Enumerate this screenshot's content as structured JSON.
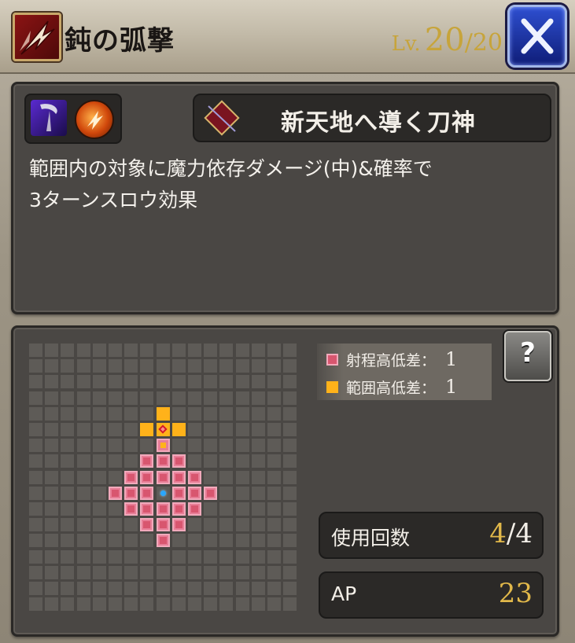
{
  "header": {
    "skill_name": "鈍の弧撃",
    "level_prefix": "Lv.",
    "level_current": "20",
    "level_separator": "/",
    "level_max": "20",
    "skill_type_icon": "slash-icon",
    "close_icon": "close-icon"
  },
  "info": {
    "element_icons": [
      "weapon-scythe-icon",
      "fire-element-icon"
    ],
    "source_icon": "book-icon",
    "source_name": "新天地へ導く刀神",
    "description": "範囲内の対象に魔力依存ダメージ(中)&確率で\n3ターンスロウ効果"
  },
  "range_map": {
    "grid_size": 17,
    "colors": {
      "range": "#d8566f",
      "area": "#ffb21a",
      "origin": "#2aa7ff"
    },
    "range_cells": [
      [
        8,
        6
      ],
      [
        8,
        7
      ],
      [
        7,
        7
      ],
      [
        9,
        7
      ],
      [
        6,
        8
      ],
      [
        7,
        8
      ],
      [
        8,
        8
      ],
      [
        9,
        8
      ],
      [
        10,
        8
      ],
      [
        5,
        9
      ],
      [
        6,
        9
      ],
      [
        7,
        9
      ],
      [
        9,
        9
      ],
      [
        10,
        9
      ],
      [
        11,
        9
      ],
      [
        6,
        10
      ],
      [
        7,
        10
      ],
      [
        8,
        10
      ],
      [
        9,
        10
      ],
      [
        10,
        10
      ],
      [
        7,
        11
      ],
      [
        8,
        11
      ],
      [
        9,
        11
      ],
      [
        8,
        12
      ]
    ],
    "area_cells": [
      [
        8,
        4
      ],
      [
        7,
        5
      ],
      [
        9,
        5
      ]
    ],
    "range_area_cells": [
      [
        8,
        6
      ]
    ],
    "target_cells": [
      [
        8,
        5
      ]
    ],
    "origin_cell": [
      8,
      9
    ]
  },
  "legend": {
    "range_label": "射程高低差：",
    "range_value": "1",
    "area_label": "範囲高低差：",
    "area_value": "1"
  },
  "help": {
    "label": "?"
  },
  "stats": {
    "uses_label": "使用回数",
    "uses_current": "4",
    "uses_separator": "/",
    "uses_max": "4",
    "ap_label": "AP",
    "ap_value": "23"
  }
}
